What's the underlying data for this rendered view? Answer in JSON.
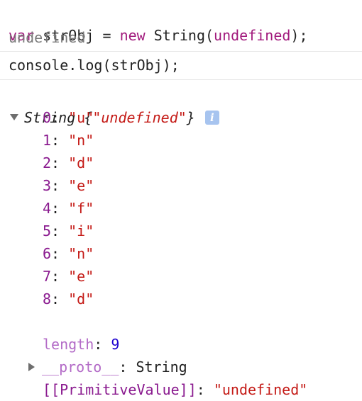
{
  "input1": {
    "var_kw": "var",
    "name": "strObj",
    "eq": "=",
    "new_kw": "new",
    "ctor": "String(",
    "arg": "undefined",
    "close": ");"
  },
  "result1": "undefined",
  "input2": "console.log(strObj);",
  "object": {
    "type": "String",
    "open": "{",
    "preview": "\"undefined\"",
    "close": "}",
    "info_icon": "i",
    "entries": [
      {
        "key": "0",
        "value": "\"u\""
      },
      {
        "key": "1",
        "value": "\"n\""
      },
      {
        "key": "2",
        "value": "\"d\""
      },
      {
        "key": "3",
        "value": "\"e\""
      },
      {
        "key": "4",
        "value": "\"f\""
      },
      {
        "key": "5",
        "value": "\"i\""
      },
      {
        "key": "6",
        "value": "\"n\""
      },
      {
        "key": "7",
        "value": "\"e\""
      },
      {
        "key": "8",
        "value": "\"d\""
      }
    ],
    "length_key": "length",
    "length_value": "9",
    "proto_key": "__proto__",
    "proto_value": "String",
    "primitive_key": "[[PrimitiveValue]]",
    "primitive_value": "\"undefined\""
  },
  "colors": {
    "keyword": "#a1197c",
    "string": "#c41a16",
    "property": "#8a1a8f",
    "number": "#1c00cf",
    "info_badge": "#a7c4ef"
  }
}
